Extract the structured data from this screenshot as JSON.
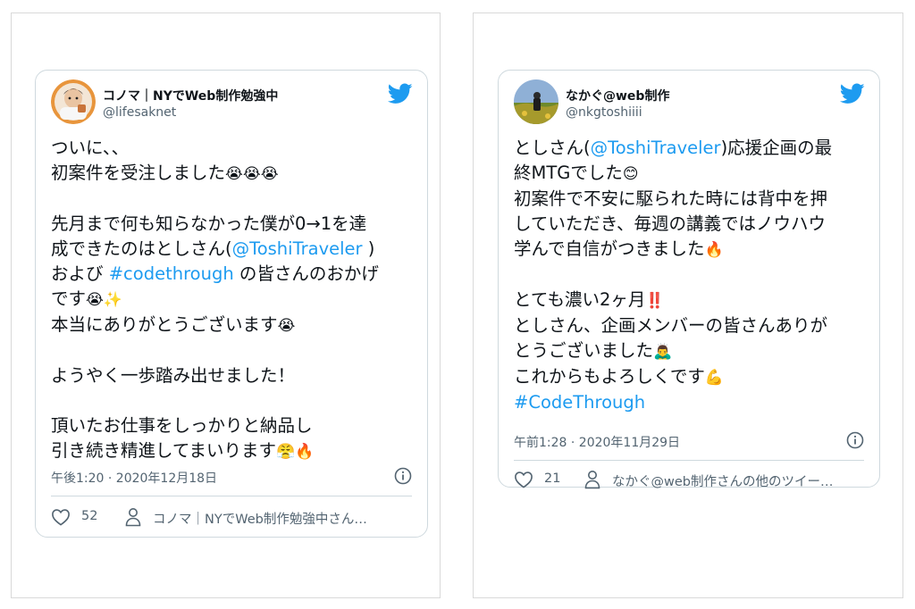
{
  "tweets": [
    {
      "author_name": "コノマ｜NYでWeb制作勉強中",
      "author_handle": "@lifesaknet",
      "avatar_icon": "person-photo-avatar",
      "lines": [
        [
          {
            "t": "ついに、、"
          }
        ],
        [
          {
            "t": "初案件を受注しました"
          },
          {
            "t": "😭😭😭",
            "emoji": true
          }
        ],
        [
          {
            "t": ""
          }
        ],
        [
          {
            "t": "先月まで何も知らなかった僕が0→1を達"
          }
        ],
        [
          {
            "t": "成できたのはとしさん("
          },
          {
            "t": "@ToshiTraveler",
            "link": true
          },
          {
            "t": " )"
          }
        ],
        [
          {
            "t": "および "
          },
          {
            "t": "#codethrough",
            "link": true
          },
          {
            "t": " の皆さんのおかげ"
          }
        ],
        [
          {
            "t": "です"
          },
          {
            "t": "😭✨",
            "emoji": true
          }
        ],
        [
          {
            "t": "本当にありがとうございます"
          },
          {
            "t": "😭",
            "emoji": true
          }
        ],
        [
          {
            "t": ""
          }
        ],
        [
          {
            "t": "ようやく一歩踏み出せました！"
          }
        ],
        [
          {
            "t": ""
          }
        ],
        [
          {
            "t": "頂いたお仕事をしっかりと納品し"
          }
        ],
        [
          {
            "t": "引き続き精進してまいります"
          },
          {
            "t": "😤🔥",
            "emoji": true
          }
        ]
      ],
      "timestamp": "午後1:20 · 2020年12月18日",
      "likes": "52",
      "others_link": "コノマ｜NYでWeb制作勉強中さん…"
    },
    {
      "author_name": "なかぐ@web制作",
      "author_handle": "@nkgtoshiiii",
      "avatar_icon": "landscape-photo-avatar",
      "lines": [
        [
          {
            "t": "としさん("
          },
          {
            "t": "@ToshiTraveler",
            "link": true
          },
          {
            "t": ")応援企画の最"
          }
        ],
        [
          {
            "t": "終MTGでした"
          },
          {
            "t": "😊",
            "emoji": true
          }
        ],
        [
          {
            "t": "初案件で不安に駆られた時には背中を押"
          }
        ],
        [
          {
            "t": "していただき、毎週の講義ではノウハウ"
          }
        ],
        [
          {
            "t": "学んで自信がつきました"
          },
          {
            "t": "🔥",
            "emoji": true
          }
        ],
        [
          {
            "t": ""
          }
        ],
        [
          {
            "t": "とても濃い2ヶ月"
          },
          {
            "t": "‼️",
            "emoji": true
          }
        ],
        [
          {
            "t": "としさん、企画メンバーの皆さんありが"
          }
        ],
        [
          {
            "t": "とうございました"
          },
          {
            "t": "🙇‍♂️",
            "emoji": true
          }
        ],
        [
          {
            "t": "これからもよろしくです"
          },
          {
            "t": "💪",
            "emoji": true
          }
        ],
        [
          {
            "t": "#CodeThrough",
            "link": true
          }
        ]
      ],
      "timestamp": "午前1:28 · 2020年11月29日",
      "likes": "21",
      "others_link": "なかぐ@web制作さんの他のツイー…"
    }
  ],
  "icons": {
    "brand": "twitter-bird-icon",
    "info": "info-icon",
    "like": "heart-icon",
    "profile": "person-icon"
  },
  "colors": {
    "twitter_blue": "#1d9bf0",
    "text": "#0f1419",
    "secondary": "#536471",
    "border": "#cfd9de"
  }
}
